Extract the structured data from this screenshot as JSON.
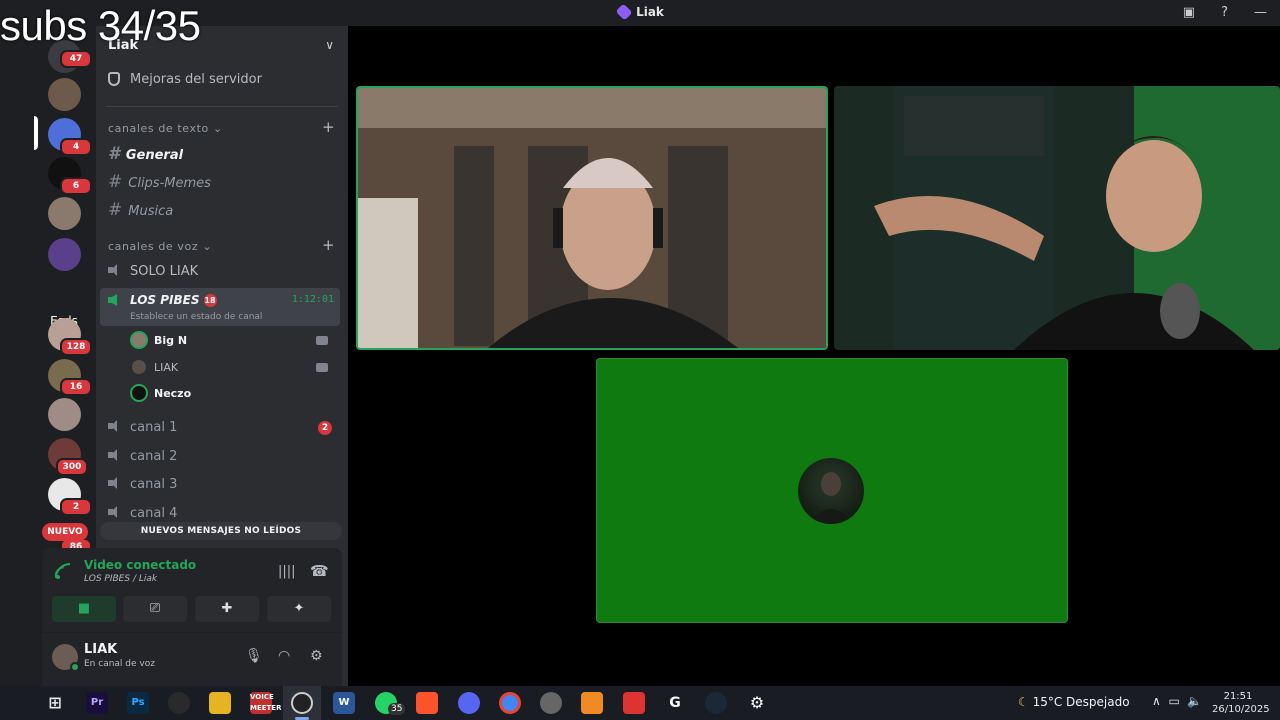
{
  "overlay": {
    "text": "subs 34/35"
  },
  "window": {
    "title": "Liak"
  },
  "server": {
    "name": "Liak",
    "boost_label": "Mejoras del servidor"
  },
  "guilds": {
    "badges": [
      "47",
      "4",
      "6",
      "128",
      "16",
      "300",
      "2",
      "86"
    ],
    "folder_label": "Esds",
    "new_label": "NUEVO"
  },
  "categories": {
    "text": "canales de texto",
    "voice": "canales de voz"
  },
  "text_channels": [
    {
      "name": "General"
    },
    {
      "name": "Clips-Memes"
    },
    {
      "name": "Musica"
    }
  ],
  "voice_channels": {
    "solo": "SOLO LIAK",
    "active": {
      "name": "LOS PIBES",
      "age": "18",
      "timer": "1:12:01",
      "status": "Establece un estado de canal"
    },
    "users": [
      "Big N",
      "LIAK",
      "Neczo"
    ],
    "others": [
      {
        "name": "canal 1",
        "badge": "2"
      },
      {
        "name": "canal 2"
      },
      {
        "name": "canal 3"
      },
      {
        "name": "canal 4"
      }
    ]
  },
  "unread_bar": "NUEVOS MENSAJES NO LEÍDOS",
  "voice_panel": {
    "status": "Video conectado",
    "subtitle": "LOS PIBES",
    "subtitle_server": "/ Liak"
  },
  "user_panel": {
    "name": "LIAK",
    "status": "En canal de voz"
  },
  "taskbar": {
    "whatsapp_badge": "35",
    "weather": "15°C  Despejado",
    "time": "21:51",
    "date": "26/10/2025"
  },
  "colors": {
    "accent_green": "#23a55a",
    "danger": "#da373c",
    "green_tile": "#0f7a0f"
  }
}
